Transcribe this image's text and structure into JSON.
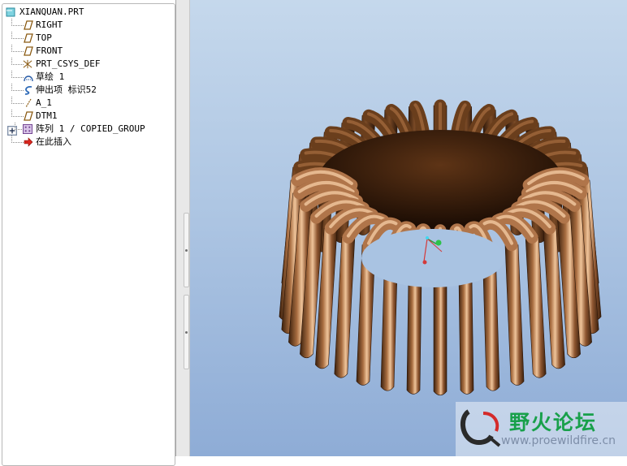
{
  "model_tree": {
    "root": {
      "label": "XIANQUAN.PRT",
      "icon": "part-icon"
    },
    "items": [
      {
        "name": "datum-plane-right",
        "label": "RIGHT",
        "icon": "datum-plane-icon"
      },
      {
        "name": "datum-plane-top",
        "label": "TOP",
        "icon": "datum-plane-icon"
      },
      {
        "name": "datum-plane-front",
        "label": "FRONT",
        "icon": "datum-plane-icon"
      },
      {
        "name": "coordinate-system",
        "label": "PRT_CSYS_DEF",
        "icon": "csys-icon"
      },
      {
        "name": "sketch-feature",
        "label": "草绘 1",
        "icon": "sketch-icon"
      },
      {
        "name": "extrude-feature",
        "label": "伸出项 标识52",
        "icon": "sweep-icon"
      },
      {
        "name": "datum-axis",
        "label": "A_1",
        "icon": "datum-axis-icon"
      },
      {
        "name": "datum-plane-dtm1",
        "label": "DTM1",
        "icon": "datum-plane-icon"
      },
      {
        "name": "pattern-feature",
        "label": "阵列 1 / COPIED_GROUP",
        "icon": "pattern-icon",
        "expandable": true
      },
      {
        "name": "insert-here",
        "label": "在此插入",
        "icon": "insert-arrow-icon"
      }
    ]
  },
  "model": {
    "description_colors": {
      "copper": "#a46a3c",
      "copper_light": "#efc49a",
      "copper_dark": "#40230f"
    }
  },
  "viewport": {
    "bg_top": "#c5d8ec",
    "bg_bottom": "#8eacd6"
  },
  "watermark": {
    "title": "野火论坛",
    "url": "www.proewildfire.cn"
  }
}
